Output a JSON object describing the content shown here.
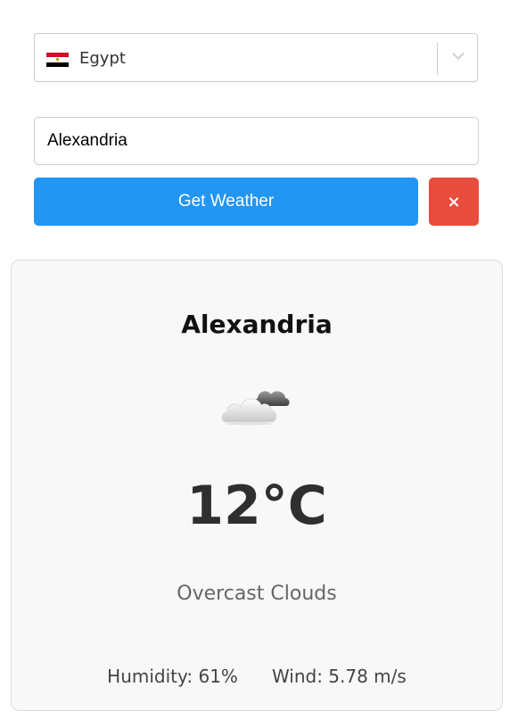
{
  "country_select": {
    "selected_label": "Egypt",
    "flag_icon": "egypt-flag-icon",
    "dropdown_icon": "chevron-down-icon"
  },
  "city_input": {
    "value": "Alexandria"
  },
  "buttons": {
    "get_weather_label": "Get Weather",
    "clear_label": "×"
  },
  "weather_card": {
    "city": "Alexandria",
    "icon": "overcast-clouds-icon",
    "temperature": "12°C",
    "description": "Overcast Clouds",
    "humidity": "Humidity: 61%",
    "wind": "Wind: 5.78 m/s"
  },
  "colors": {
    "primary_button": "#2196f3",
    "clear_button": "#e74c3c",
    "card_background": "#f8f8f8"
  }
}
